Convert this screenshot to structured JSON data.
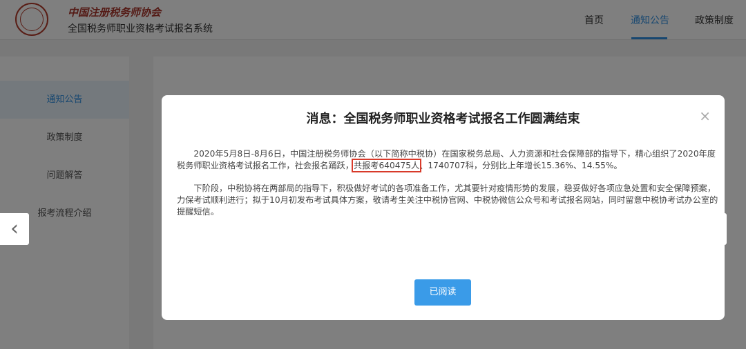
{
  "header": {
    "org_name": "中国注册税务师协会",
    "system_name": "全国税务师职业资格考试报名系统",
    "nav": [
      {
        "label": "首页"
      },
      {
        "label": "通知公告"
      },
      {
        "label": "政策制度"
      }
    ]
  },
  "sidebar": {
    "items": [
      {
        "label": "通知公告"
      },
      {
        "label": "政策制度"
      },
      {
        "label": "问题解答"
      },
      {
        "label": "报考流程介绍"
      }
    ]
  },
  "modal": {
    "title": "消息：全国税务师职业资格考试报名工作圆满结束",
    "close": "×",
    "para1_before": "2020年5月8日-8月6日，中国注册税务师协会（以下简称中税协）在国家税务总局、人力资源和社会保障部的指导下，精心组织了2020年度税务师职业资格考试报名工作，社会报名踊跃，",
    "para1_highlight": "共报考640475人",
    "para1_after": "、1740707科，分别比上年增长15.36%、14.55%。",
    "para2": "下阶段，中税协将在两部局的指导下，积极做好考试的各项准备工作，尤其要针对疫情形势的发展，稳妥做好各项应急处置和安全保障预案，力保考试顺利进行；拟于10月初发布考试具体方案，敬请考生关注中税协官网、中税协微信公众号和考试报名网站，同时留意中税协考试办公室的提醒短信。",
    "read_button": "已阅读"
  },
  "carousel": {
    "prev": "‹",
    "next": "›"
  },
  "colors": {
    "accent": "#2f8fe0",
    "button": "#3a9be8",
    "highlight_border": "#d83a2a"
  }
}
